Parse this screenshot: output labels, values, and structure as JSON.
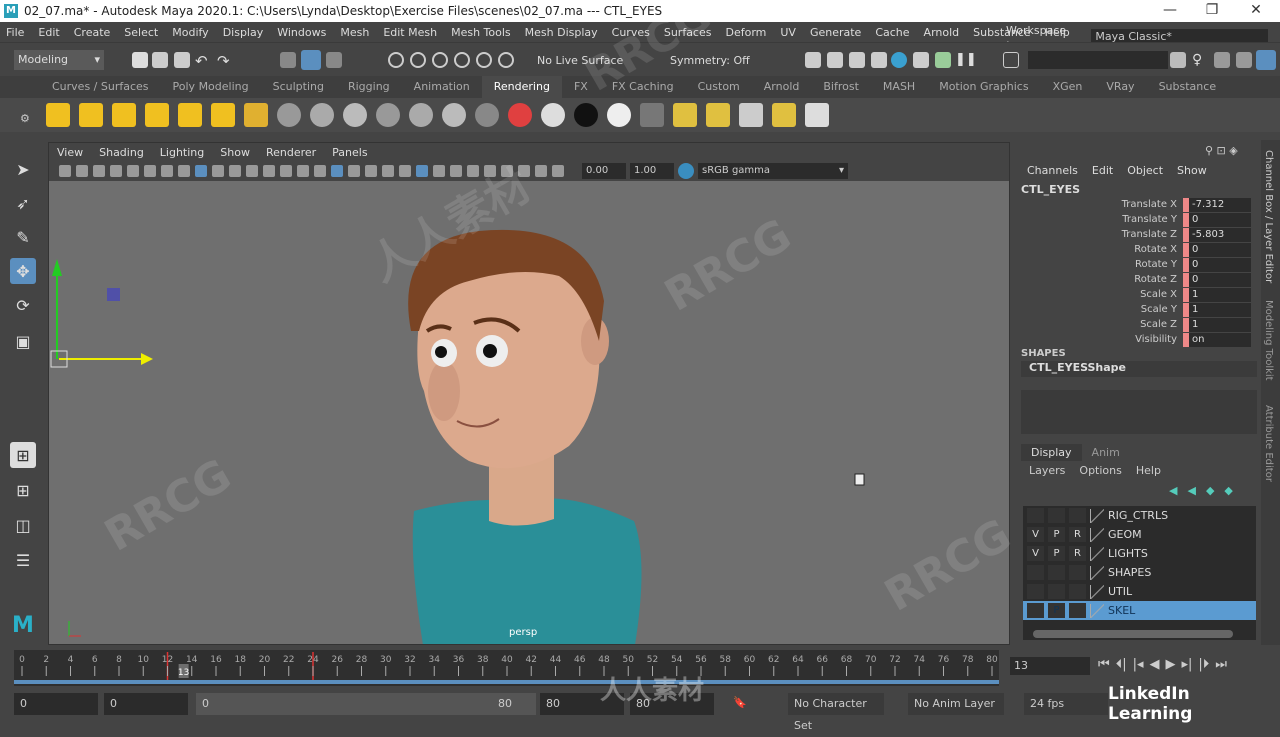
{
  "title": "02_07.ma* - Autodesk Maya 2020.1: C:\\Users\\Lynda\\Desktop\\Exercise Files\\scenes\\02_07.ma   ---   CTL_EYES",
  "window_controls": {
    "minimize": "—",
    "maximize": "❐",
    "close": "✕"
  },
  "menus": [
    "File",
    "Edit",
    "Create",
    "Select",
    "Modify",
    "Display",
    "Windows",
    "Mesh",
    "Edit Mesh",
    "Mesh Tools",
    "Mesh Display",
    "Curves",
    "Surfaces",
    "Deform",
    "UV",
    "Generate",
    "Cache",
    "Arnold",
    "Substance",
    "Help"
  ],
  "workspace": {
    "label": "Workspace :",
    "value": "Maya Classic*"
  },
  "statusline": {
    "menuset": "Modeling",
    "live_surface": "No Live Surface",
    "symmetry": "Symmetry: Off"
  },
  "shelf_tabs": [
    "Curves / Surfaces",
    "Poly Modeling",
    "Sculpting",
    "Rigging",
    "Animation",
    "Rendering",
    "FX",
    "FX Caching",
    "Custom",
    "Arnold",
    "Bifrost",
    "MASH",
    "Motion Graphics",
    "XGen",
    "VRay",
    "Substance"
  ],
  "active_shelf": "Rendering",
  "shelf_icons": [
    {
      "name": "ambient-light-icon",
      "color": "#f0c020"
    },
    {
      "name": "directional-light-icon",
      "color": "#f0c020"
    },
    {
      "name": "point-light-icon",
      "color": "#f0c020"
    },
    {
      "name": "spot-light-icon",
      "color": "#f0c020"
    },
    {
      "name": "area-light-icon",
      "color": "#f0c020"
    },
    {
      "name": "volume-light-icon",
      "color": "#f0c020"
    },
    {
      "name": "create-camera-icon",
      "color": "#e0b030"
    },
    {
      "name": "material-sphere-1-icon",
      "color": "#999"
    },
    {
      "name": "material-sphere-2-icon",
      "color": "#aaa"
    },
    {
      "name": "material-sphere-3-icon",
      "color": "#bbb"
    },
    {
      "name": "material-sphere-4-icon",
      "color": "#999"
    },
    {
      "name": "material-sphere-5-icon",
      "color": "#aaa"
    },
    {
      "name": "material-sphere-6-icon",
      "color": "#bbb"
    },
    {
      "name": "striped-sphere-icon",
      "color": "#888"
    },
    {
      "name": "ramp-sphere-icon",
      "color": "#e04040"
    },
    {
      "name": "white-sphere-icon",
      "color": "#ddd"
    },
    {
      "name": "black-sphere-icon",
      "color": "#111"
    },
    {
      "name": "white-sphere-2-icon",
      "color": "#eee"
    },
    {
      "name": "hypershade-icon",
      "color": "#777"
    },
    {
      "name": "render-view-icon",
      "color": "#e0c040"
    },
    {
      "name": "render-settings-icon",
      "color": "#e0c040"
    },
    {
      "name": "render-layer-icon",
      "color": "#ccc"
    },
    {
      "name": "batch-render-icon",
      "color": "#e0c040"
    },
    {
      "name": "ipr-render-icon",
      "color": "#ddd"
    }
  ],
  "panel": {
    "menus": [
      "View",
      "Shading",
      "Lighting",
      "Show",
      "Renderer",
      "Panels"
    ],
    "exposure": "0.00",
    "gamma": "1.00",
    "color_space": "sRGB gamma",
    "camera": "persp"
  },
  "channel_box": {
    "menus": [
      "Channels",
      "Edit",
      "Object",
      "Show"
    ],
    "object": "CTL_EYES",
    "attributes": [
      {
        "name": "Translate X",
        "value": "-7.312"
      },
      {
        "name": "Translate Y",
        "value": "0"
      },
      {
        "name": "Translate Z",
        "value": "-5.803"
      },
      {
        "name": "Rotate X",
        "value": "0"
      },
      {
        "name": "Rotate Y",
        "value": "0"
      },
      {
        "name": "Rotate Z",
        "value": "0"
      },
      {
        "name": "Scale X",
        "value": "1"
      },
      {
        "name": "Scale Y",
        "value": "1"
      },
      {
        "name": "Scale Z",
        "value": "1"
      },
      {
        "name": "Visibility",
        "value": "on"
      }
    ],
    "shapes_header": "SHAPES",
    "shape": "CTL_EYESShape"
  },
  "layer_editor": {
    "tabs": [
      "Display",
      "Anim"
    ],
    "menus": [
      "Layers",
      "Options",
      "Help"
    ],
    "layers": [
      {
        "name": "RIG_CTRLS",
        "v": "",
        "p": "",
        "r": ""
      },
      {
        "name": "GEOM",
        "v": "V",
        "p": "P",
        "r": "R"
      },
      {
        "name": "LIGHTS",
        "v": "V",
        "p": "P",
        "r": "R"
      },
      {
        "name": "SHAPES",
        "v": "",
        "p": "",
        "r": ""
      },
      {
        "name": "UTIL",
        "v": "",
        "p": "",
        "r": ""
      },
      {
        "name": "SKEL",
        "v": "",
        "p": "P",
        "r": "",
        "selected": true
      }
    ]
  },
  "side_tabs": [
    "Channel Box / Layer Editor",
    "Modeling Toolkit",
    "Attribute Editor"
  ],
  "timeline": {
    "start": 0,
    "end": 80,
    "step": 2,
    "current_frame": "13",
    "current": 13,
    "keys": [
      12,
      24
    ]
  },
  "range": {
    "anim_start": "0",
    "playback_start": "0",
    "slider_start": "0",
    "slider_end": "80",
    "playback_end": "80",
    "anim_end": "80",
    "character_set": "No Character Set",
    "anim_layer": "No Anim Layer",
    "fps": "24 fps"
  },
  "playback_buttons": [
    "⏮",
    "⏴|",
    "|◂",
    "◀",
    "▶",
    "▸|",
    "|⏵",
    "⏭"
  ],
  "watermark": {
    "brand": "LinkedIn Learning",
    "text1": "RRCG",
    "text2": "人人素材"
  }
}
